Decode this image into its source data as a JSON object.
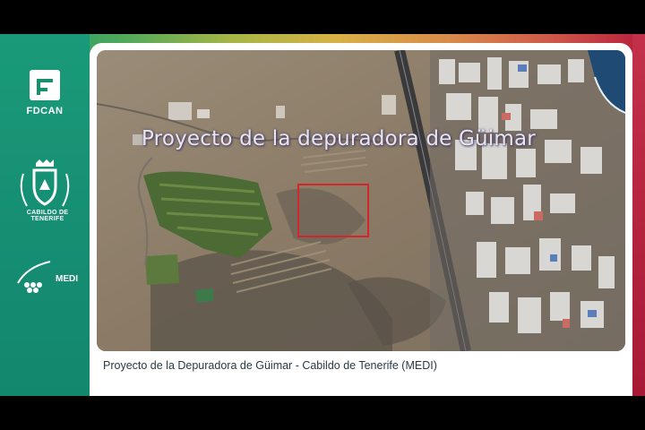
{
  "slide": {
    "map_title": "Proyecto de la depuradora de Güimar",
    "caption": "Proyecto de la Depuradora de Güimar - Cabildo de Tenerife (MEDI)"
  },
  "logos": {
    "fdcan": "FDCAN",
    "cabildo": "CABILDO DE TENERIFE",
    "medi": "MEDI"
  },
  "colors": {
    "left_band": "#168f73",
    "right_band": "#b81e3c",
    "highlight_box": "#d6232c"
  }
}
